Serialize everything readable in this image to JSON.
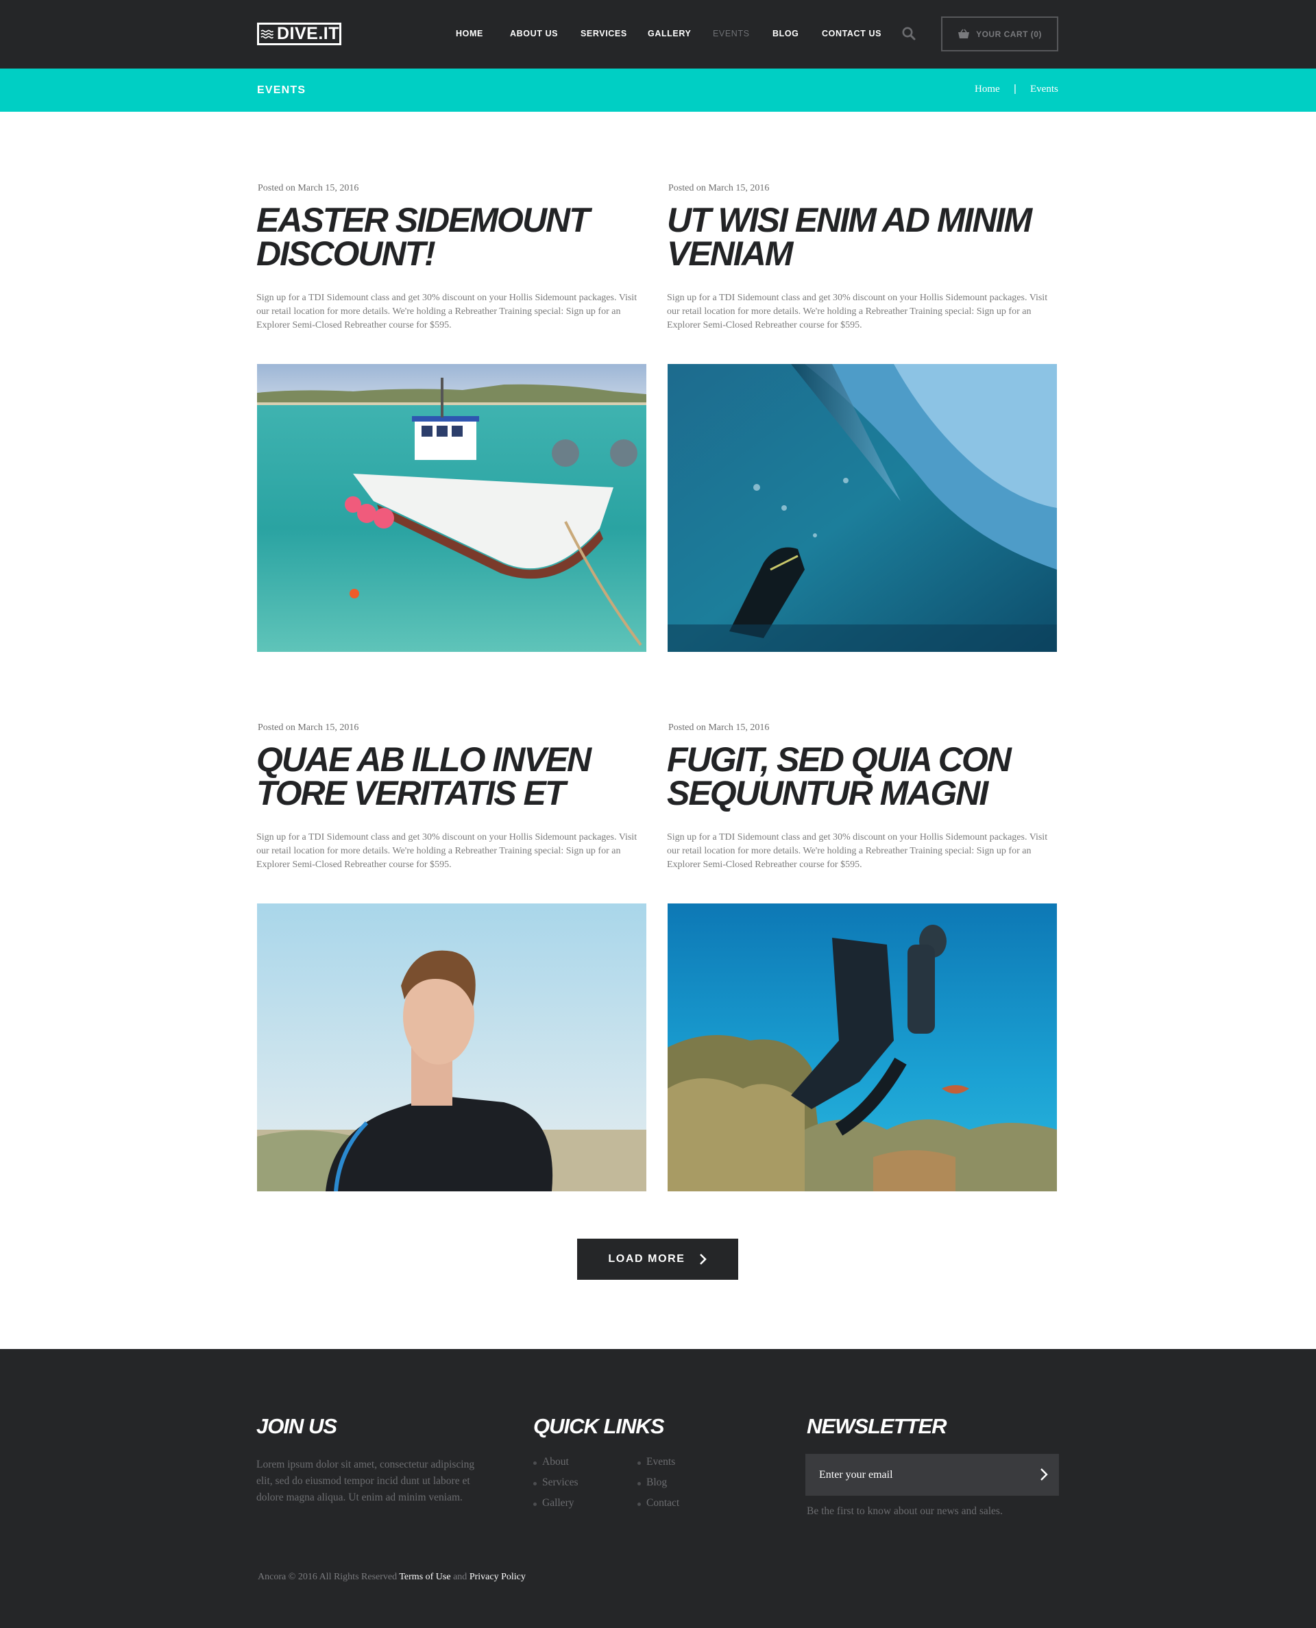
{
  "brand": {
    "logo_text": "DIVE.IT"
  },
  "nav": {
    "items": [
      {
        "label": "HOME"
      },
      {
        "label": "ABOUT US"
      },
      {
        "label": "SERVICES"
      },
      {
        "label": "GALLERY"
      },
      {
        "label": "EVENTS",
        "active": true
      },
      {
        "label": "BLOG"
      },
      {
        "label": "CONTACT US"
      }
    ],
    "cart_label": "YOUR CART (0)"
  },
  "page_header": {
    "title": "EVENTS",
    "breadcrumb": {
      "home": "Home",
      "separator": "|",
      "current": "Events"
    },
    "accent_color": "#00cfc4"
  },
  "events": [
    {
      "date": "Posted on March 15, 2016",
      "title": "EASTER SIDEMOUNT DISCOUNT!",
      "text": "Sign up for a TDI Sidemount class and get 30% discount on your Hollis Sidemount packages. Visit our retail location for more details. We're holding a Rebreather Training special: Sign up for an Explorer Semi-Closed Rebreather course for $595.",
      "image": "boat-photo"
    },
    {
      "date": "Posted on March 15, 2016",
      "title": "UT WISI ENIM AD MINIM VENIAM",
      "text": "Sign up for a TDI Sidemount class and get 30% discount on your Hollis Sidemount packages. Visit our retail location for more details. We're holding a Rebreather Training special: Sign up for an Explorer Semi-Closed Rebreather course for $595.",
      "image": "underwater-wave-photo"
    },
    {
      "date": "Posted on March 15, 2016",
      "title": "QUAE AB ILLO INVEN TORE VERITATIS ET",
      "text": "Sign up for a TDI Sidemount class and get 30% discount on your Hollis Sidemount packages. Visit our retail location for more details. We're holding a Rebreather Training special: Sign up for an Explorer Semi-Closed Rebreather course for $595.",
      "image": "man-wetsuit-photo"
    },
    {
      "date": "Posted on March 15, 2016",
      "title": "FUGIT, SED QUIA CON SEQUUNTUR MAGNI",
      "text": "Sign up for a TDI Sidemount class and get 30% discount on your Hollis Sidemount packages. Visit our retail location for more details. We're holding a Rebreather Training special: Sign up for an Explorer Semi-Closed Rebreather course for $595.",
      "image": "scuba-diver-reef-photo"
    }
  ],
  "load_more": {
    "label": "LOAD MORE"
  },
  "footer": {
    "join": {
      "heading": "JOIN US",
      "text": "Lorem ipsum dolor sit amet, consectetur adipiscing elit, sed do eiusmod tempor incid dunt ut labore et dolore magna aliqua. Ut enim ad minim veniam."
    },
    "quick_links": {
      "heading": "QUICK LINKS",
      "links": [
        "About",
        "Services",
        "Gallery",
        "Events",
        "Blog",
        "Contact"
      ]
    },
    "newsletter": {
      "heading": "NEWSLETTER",
      "placeholder": "Enter your email",
      "note": "Be the first to know about our news and sales."
    },
    "copyright": {
      "prefix": "Ancora © 2016 All Rights Reserved",
      "terms": "Terms of Use",
      "and": "and",
      "privacy": "Privacy Policy"
    }
  }
}
